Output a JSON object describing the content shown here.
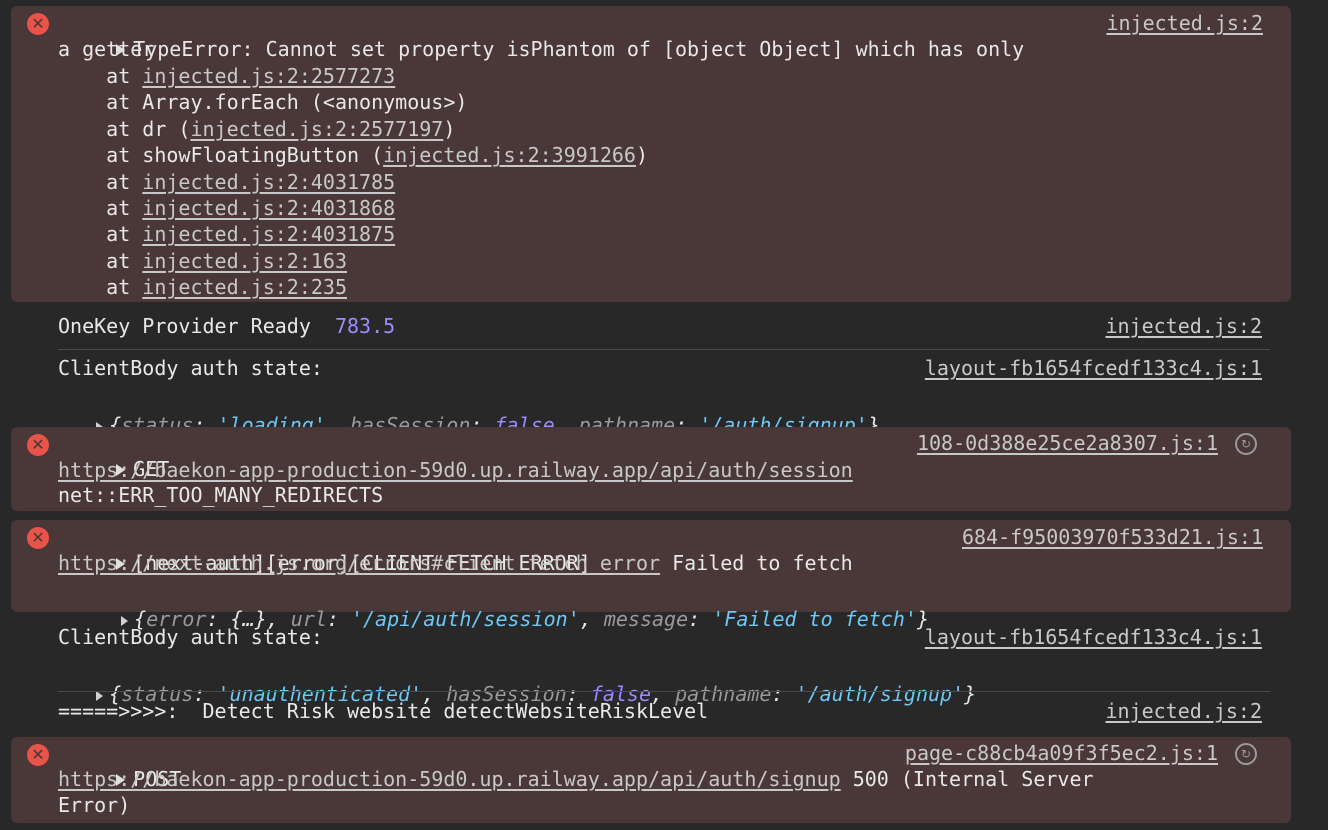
{
  "error1": {
    "title_line1": "TypeError: Cannot set property isPhantom of [object Object] which has only",
    "title_line2": "a getter",
    "source": "injected.js:2",
    "stack": [
      {
        "prefix": "    at ",
        "link": "injected.js:2:2577273",
        "suffix": ""
      },
      {
        "prefix": "    at Array.forEach (<anonymous>)",
        "link": "",
        "suffix": ""
      },
      {
        "prefix": "    at dr (",
        "link": "injected.js:2:2577197",
        "suffix": ")"
      },
      {
        "prefix": "    at showFloatingButton (",
        "link": "injected.js:2:3991266",
        "suffix": ")"
      },
      {
        "prefix": "    at ",
        "link": "injected.js:2:4031785",
        "suffix": ""
      },
      {
        "prefix": "    at ",
        "link": "injected.js:2:4031868",
        "suffix": ""
      },
      {
        "prefix": "    at ",
        "link": "injected.js:2:4031875",
        "suffix": ""
      },
      {
        "prefix": "    at ",
        "link": "injected.js:2:163",
        "suffix": ""
      },
      {
        "prefix": "    at ",
        "link": "injected.js:2:235",
        "suffix": ""
      }
    ]
  },
  "log1": {
    "text": "OneKey Provider Ready ",
    "number": "783.5",
    "source": "injected.js:2"
  },
  "log2": {
    "text": "ClientBody auth state:",
    "source": "layout-fb1654fcedf133c4.js:1",
    "obj": {
      "k1": "status",
      "v1": "'loading'",
      "k2": "hasSession",
      "v2": "false",
      "k3": "pathname",
      "v3": "'/auth/signup'"
    }
  },
  "error2": {
    "method": "GET",
    "source": "108-0d388e25ce2a8307.js:1",
    "url": "https://baekon-app-production-59d0.up.railway.app/api/auth/session",
    "message": "net::ERR_TOO_MANY_REDIRECTS"
  },
  "error3": {
    "title": "[next-auth][error][CLIENT_FETCH_ERROR]",
    "source": "684-f95003970f533d21.js:1",
    "link": "https://next-auth.js.org/errors#client_fetch_error",
    "message": " Failed to fetch",
    "obj": {
      "k1": "error",
      "v1": "{…}",
      "k2": "url",
      "v2": "'/api/auth/session'",
      "k3": "message",
      "v3": "'Failed to fetch'"
    }
  },
  "log3": {
    "text": "ClientBody auth state:",
    "source": "layout-fb1654fcedf133c4.js:1",
    "obj": {
      "k1": "status",
      "v1": "'unauthenticated'",
      "k2": "hasSession",
      "v2": "false",
      "k3": "pathname",
      "v3": "'/auth/signup'"
    }
  },
  "log4": {
    "text": "=====>>>>:  Detect Risk website detectWebsiteRiskLevel",
    "source": "injected.js:2"
  },
  "error4": {
    "method": "POST",
    "source": "page-c88cb4a09f3f5ec2.js:1",
    "url": "https://baekon-app-production-59d0.up.railway.app/api/auth/signup",
    "message_line1": " 500 (Internal Server",
    "message_line2": "Error)"
  },
  "colors": {
    "error_bg": "#4a3737",
    "error_icon": "#e8534a",
    "number": "#9b8cff",
    "string": "#6ec7f5"
  }
}
